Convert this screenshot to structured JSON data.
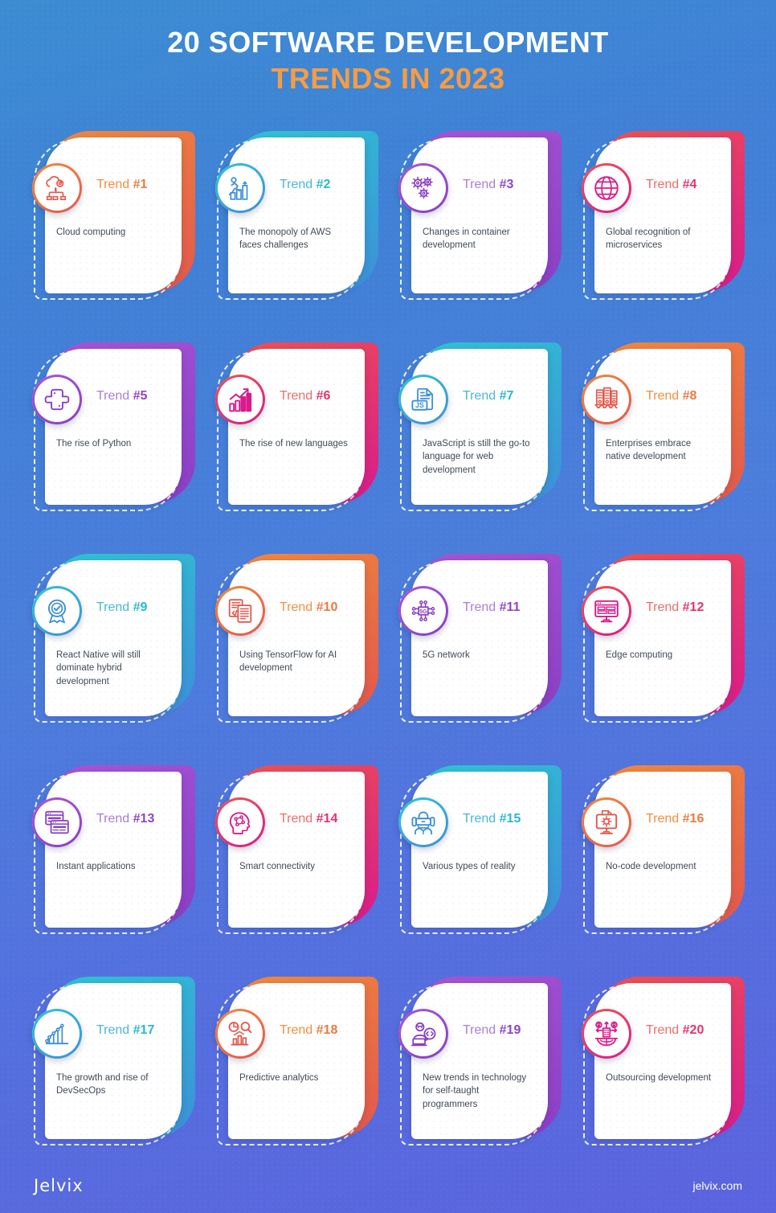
{
  "header": {
    "title_line1": "20 SOFTWARE DEVELOPMENT",
    "title_line2": "TRENDS IN 2023",
    "line1_color": "#ffffff",
    "line2_color": "#f79c42"
  },
  "background": {
    "top_color": "#3c8cd2",
    "bottom_color": "#5b63de"
  },
  "footer": {
    "logo": "Jelvix",
    "website": "jelvix.com"
  },
  "cards": [
    {
      "label_word": "Trend",
      "label_num": "#1",
      "description": "Cloud computing",
      "icon": "cloud-gear-icon",
      "color_start": "#f08a3c",
      "color_end": "#e2574c",
      "text_color": "#ef8f3f",
      "num_color": "#ec7a41"
    },
    {
      "label_word": "Trend",
      "label_num": "#2",
      "description": "The monopoly of AWS faces challenges",
      "icon": "person-growth-icon",
      "color_start": "#2ec5d3",
      "color_end": "#3d8fd8",
      "text_color": "#4ab6d8",
      "num_color": "#29b9cf"
    },
    {
      "label_word": "Trend",
      "label_num": "#3",
      "description": "Changes in container development",
      "icon": "gears-icon",
      "color_start": "#a855d6",
      "color_end": "#8a3fc4",
      "text_color": "#a97fd6",
      "num_color": "#8e44c9"
    },
    {
      "label_word": "Trend",
      "label_num": "#4",
      "description": "Global recognition of microservices",
      "icon": "globe-icon",
      "color_start": "#ef5350",
      "color_end": "#d81b8c",
      "text_color": "#ef6d66",
      "num_color": "#e5336f"
    },
    {
      "label_word": "Trend",
      "label_num": "#5",
      "description": "The rise of Python",
      "icon": "python-icon",
      "color_start": "#a855d6",
      "color_end": "#8a3fc4",
      "text_color": "#a97fd6",
      "num_color": "#8e44c9"
    },
    {
      "label_word": "Trend",
      "label_num": "#6",
      "description": "The rise of new languages",
      "icon": "bar-growth-icon",
      "color_start": "#ef5350",
      "color_end": "#d81b8c",
      "text_color": "#ef6d66",
      "num_color": "#e5336f"
    },
    {
      "label_word": "Trend",
      "label_num": "#7",
      "description": "JavaScript is still the go-to language for web development",
      "icon": "js-document-icon",
      "color_start": "#2ec5d3",
      "color_end": "#3d8fd8",
      "text_color": "#4ab6d8",
      "num_color": "#29b9cf"
    },
    {
      "label_word": "Trend",
      "label_num": "#8",
      "description": "Enterprises embrace native development",
      "icon": "buildings-icon",
      "color_start": "#f08a3c",
      "color_end": "#e2574c",
      "text_color": "#ef8f3f",
      "num_color": "#ec7a41"
    },
    {
      "label_word": "Trend",
      "label_num": "#9",
      "description": "React Native will still dominate hybrid development",
      "icon": "badge-check-icon",
      "color_start": "#2ec5d3",
      "color_end": "#3d8fd8",
      "text_color": "#4ab6d8",
      "num_color": "#29b9cf"
    },
    {
      "label_word": "Trend",
      "label_num": "#10",
      "description": "Using TensorFlow for AI development",
      "icon": "code-documents-icon",
      "color_start": "#f08a3c",
      "color_end": "#e2574c",
      "text_color": "#ef8f3f",
      "num_color": "#ec7a41"
    },
    {
      "label_word": "Trend",
      "label_num": "#11",
      "description": "5G network",
      "icon": "5g-chip-icon",
      "color_start": "#a855d6",
      "color_end": "#8a3fc4",
      "text_color": "#a97fd6",
      "num_color": "#8e44c9"
    },
    {
      "label_word": "Trend",
      "label_num": "#12",
      "description": "Edge computing",
      "icon": "monitor-server-icon",
      "color_start": "#ef5350",
      "color_end": "#d81b8c",
      "text_color": "#ef6d66",
      "num_color": "#e5336f"
    },
    {
      "label_word": "Trend",
      "label_num": "#13",
      "description": "Instant applications",
      "icon": "browser-window-icon",
      "color_start": "#a855d6",
      "color_end": "#8a3fc4",
      "text_color": "#a97fd6",
      "num_color": "#8e44c9"
    },
    {
      "label_word": "Trend",
      "label_num": "#14",
      "description": "Smart connectivity",
      "icon": "ai-brain-head-icon",
      "color_start": "#ef5350",
      "color_end": "#d81b8c",
      "text_color": "#ef6d66",
      "num_color": "#e5336f"
    },
    {
      "label_word": "Trend",
      "label_num": "#15",
      "description": "Various types of reality",
      "icon": "vr-headset-icon",
      "color_start": "#2ec5d3",
      "color_end": "#3d8fd8",
      "text_color": "#4ab6d8",
      "num_color": "#29b9cf"
    },
    {
      "label_word": "Trend",
      "label_num": "#16",
      "description": "No-code development",
      "icon": "no-code-monitor-icon",
      "color_start": "#f08a3c",
      "color_end": "#e2574c",
      "text_color": "#ef8f3f",
      "num_color": "#ec7a41"
    },
    {
      "label_word": "Trend",
      "label_num": "#17",
      "description": "The growth and rise of DevSecOps",
      "icon": "growth-line-chart-icon",
      "color_start": "#2ec5d3",
      "color_end": "#3d8fd8",
      "text_color": "#4ab6d8",
      "num_color": "#29b9cf"
    },
    {
      "label_word": "Trend",
      "label_num": "#18",
      "description": "Predictive analytics",
      "icon": "analytics-search-icon",
      "color_start": "#f08a3c",
      "color_end": "#e2574c",
      "text_color": "#ef8f3f",
      "num_color": "#ec7a41"
    },
    {
      "label_word": "Trend",
      "label_num": "#19",
      "description": "New trends in technology for self-taught programmers",
      "icon": "programmer-code-icon",
      "color_start": "#a855d6",
      "color_end": "#8a3fc4",
      "text_color": "#a97fd6",
      "num_color": "#8e44c9"
    },
    {
      "label_word": "Trend",
      "label_num": "#20",
      "description": "Outsourcing development",
      "icon": "outsourcing-globe-icon",
      "color_start": "#ef5350",
      "color_end": "#d81b8c",
      "text_color": "#ef6d66",
      "num_color": "#e5336f"
    }
  ]
}
